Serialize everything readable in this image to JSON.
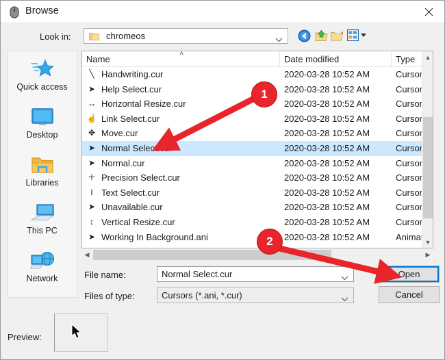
{
  "window": {
    "title": "Browse",
    "icon": "mouse-icon",
    "close_label": "Close"
  },
  "toolbar": {
    "lookin_label": "Look in:",
    "lookin_value": "chromeos",
    "icons": [
      {
        "name": "back-icon",
        "label": "Back"
      },
      {
        "name": "up-one-level-icon",
        "label": "Up One Level"
      },
      {
        "name": "create-new-folder-icon",
        "label": "Create New Folder"
      },
      {
        "name": "views-icon",
        "label": "Views"
      }
    ]
  },
  "places": [
    {
      "label": "Quick access",
      "icon": "star-icon"
    },
    {
      "label": "Desktop",
      "icon": "monitor-icon"
    },
    {
      "label": "Libraries",
      "icon": "folder-icon"
    },
    {
      "label": "This PC",
      "icon": "computer-icon"
    },
    {
      "label": "Network",
      "icon": "globe-icon"
    }
  ],
  "filelist": {
    "columns": [
      "Name",
      "Date modified",
      "Type"
    ],
    "sort_indicator": "˄",
    "rows": [
      {
        "name": "Handwriting.cur",
        "date": "2020-03-28 10:52 AM",
        "type": "Cursor",
        "icon": "handwriting-cursor-icon",
        "glyph": "╲",
        "selected": false
      },
      {
        "name": "Help Select.cur",
        "date": "2020-03-28 10:52 AM",
        "type": "Cursor",
        "icon": "help-select-cursor-icon",
        "glyph": "➤",
        "selected": false
      },
      {
        "name": "Horizontal Resize.cur",
        "date": "2020-03-28 10:52 AM",
        "type": "Cursor",
        "icon": "horizontal-resize-cursor-icon",
        "glyph": "↔",
        "selected": false
      },
      {
        "name": "Link Select.cur",
        "date": "2020-03-28 10:52 AM",
        "type": "Cursor",
        "icon": "link-select-cursor-icon",
        "glyph": "☝",
        "selected": false
      },
      {
        "name": "Move.cur",
        "date": "2020-03-28 10:52 AM",
        "type": "Cursor",
        "icon": "move-cursor-icon",
        "glyph": "✥",
        "selected": false
      },
      {
        "name": "Normal Select.cur",
        "date": "2020-03-28 10:52 AM",
        "type": "Cursor",
        "icon": "normal-select-cursor-icon",
        "glyph": "➤",
        "selected": true
      },
      {
        "name": "Normal.cur",
        "date": "2020-03-28 10:52 AM",
        "type": "Cursor",
        "icon": "normal-cursor-icon",
        "glyph": "➤",
        "selected": false
      },
      {
        "name": "Precision Select.cur",
        "date": "2020-03-28 10:52 AM",
        "type": "Cursor",
        "icon": "precision-select-cursor-icon",
        "glyph": "＋",
        "selected": false
      },
      {
        "name": "Text Select.cur",
        "date": "2020-03-28 10:52 AM",
        "type": "Cursor",
        "icon": "text-select-cursor-icon",
        "glyph": "I",
        "selected": false
      },
      {
        "name": "Unavailable.cur",
        "date": "2020-03-28 10:52 AM",
        "type": "Cursor",
        "icon": "unavailable-cursor-icon",
        "glyph": "➤",
        "selected": false
      },
      {
        "name": "Vertical Resize.cur",
        "date": "2020-03-28 10:52 AM",
        "type": "Cursor",
        "icon": "vertical-resize-cursor-icon",
        "glyph": "↕",
        "selected": false
      },
      {
        "name": "Working In Background.ani",
        "date": "2020-03-28 10:52 AM",
        "type": "Animated Cursor",
        "icon": "working-in-background-cursor-icon",
        "glyph": "➤",
        "selected": false
      }
    ]
  },
  "form": {
    "filename_label": "File name:",
    "filename_value": "Normal Select.cur",
    "filetype_label": "Files of type:",
    "filetype_value": "Cursors (*.ani, *.cur)",
    "open_label": "Open",
    "cancel_label": "Cancel"
  },
  "preview": {
    "label": "Preview:",
    "content_icon": "arrow-cursor-icon"
  },
  "annotations": [
    {
      "number": "1",
      "target": "selected-file-row"
    },
    {
      "number": "2",
      "target": "open-button"
    }
  ],
  "colors": {
    "annotation_red": "#e8252a",
    "selection_blue": "#cce8ff",
    "focus_blue": "#0078d7"
  }
}
